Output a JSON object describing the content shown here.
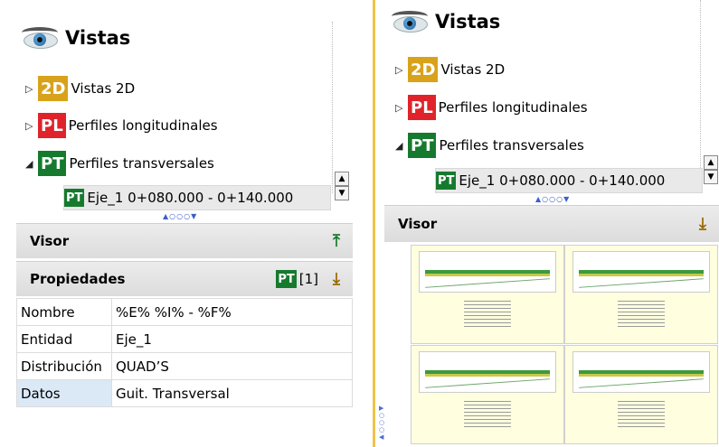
{
  "left": {
    "title": "Vistas",
    "tree": {
      "vistas2d": {
        "badge": "2D",
        "label": "Vistas 2D"
      },
      "perfiles_long": {
        "badge": "PL",
        "label": "Perfiles longitudinales"
      },
      "perfiles_trans": {
        "badge": "PT",
        "label": "Perfiles transversales"
      },
      "child": {
        "badge": "PT",
        "label": "Eje_1 0+080.000 - 0+140.000"
      }
    },
    "visor_label": "Visor",
    "propiedades_label": "Propiedades",
    "prop_badge": "PT",
    "prop_count": "[1]",
    "properties": [
      {
        "key": "Nombre",
        "value": "%E% %I% - %F%"
      },
      {
        "key": "Entidad",
        "value": "Eje_1"
      },
      {
        "key": "Distribución",
        "value": "QUAD’S"
      },
      {
        "key": "Datos",
        "value": "Guit. Transversal"
      }
    ]
  },
  "right": {
    "title": "Vistas",
    "tree": {
      "vistas2d": {
        "badge": "2D",
        "label": "Vistas 2D"
      },
      "perfiles_long": {
        "badge": "PL",
        "label": "Perfiles longitudinales"
      },
      "perfiles_trans": {
        "badge": "PT",
        "label": "Perfiles transversales"
      },
      "child": {
        "badge": "PT",
        "label": "Eje_1 0+080.000 - 0+140.000"
      }
    },
    "visor_label": "Visor"
  },
  "icons": {
    "eye": "eye-icon",
    "pin_up": "pin-up-icon",
    "pin_down": "pin-down-icon"
  },
  "colors": {
    "badge_2d": "#d8a21b",
    "badge_pl": "#e0232a",
    "badge_pt": "#167a2e",
    "splitter": "#f0c34a",
    "thumb_bg": "#ffffe0"
  }
}
